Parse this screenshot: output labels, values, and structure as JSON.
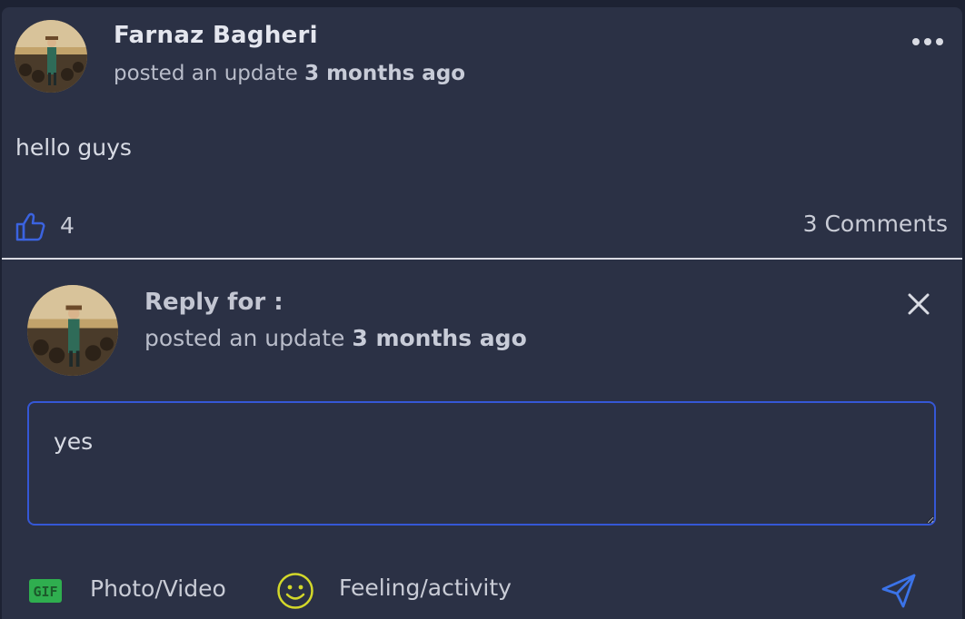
{
  "post": {
    "author": "Farnaz Bagheri",
    "action": "posted an update",
    "time": "3 months ago",
    "text": "hello guys",
    "likes": "4",
    "comments": "3 Comments"
  },
  "reply": {
    "title": "Reply for :",
    "action": "posted an update",
    "time": "3 months ago",
    "input_value": "yes"
  },
  "composer": {
    "gif_label": "GIF",
    "photo_label": "Photo/Video",
    "feeling_label": "Feeling/activity"
  },
  "icons": {
    "more": "more-dots-icon",
    "like": "thumbs-up-icon",
    "close": "close-icon",
    "gif": "gif-icon",
    "smile": "smile-icon",
    "send": "send-icon"
  },
  "colors": {
    "background": "#2b3145",
    "accent": "#3557d6",
    "like_blue": "#3b63e0",
    "gif_green": "#2fae4f",
    "smile_yellow": "#d3d82a",
    "send_blue": "#3b73e8"
  }
}
